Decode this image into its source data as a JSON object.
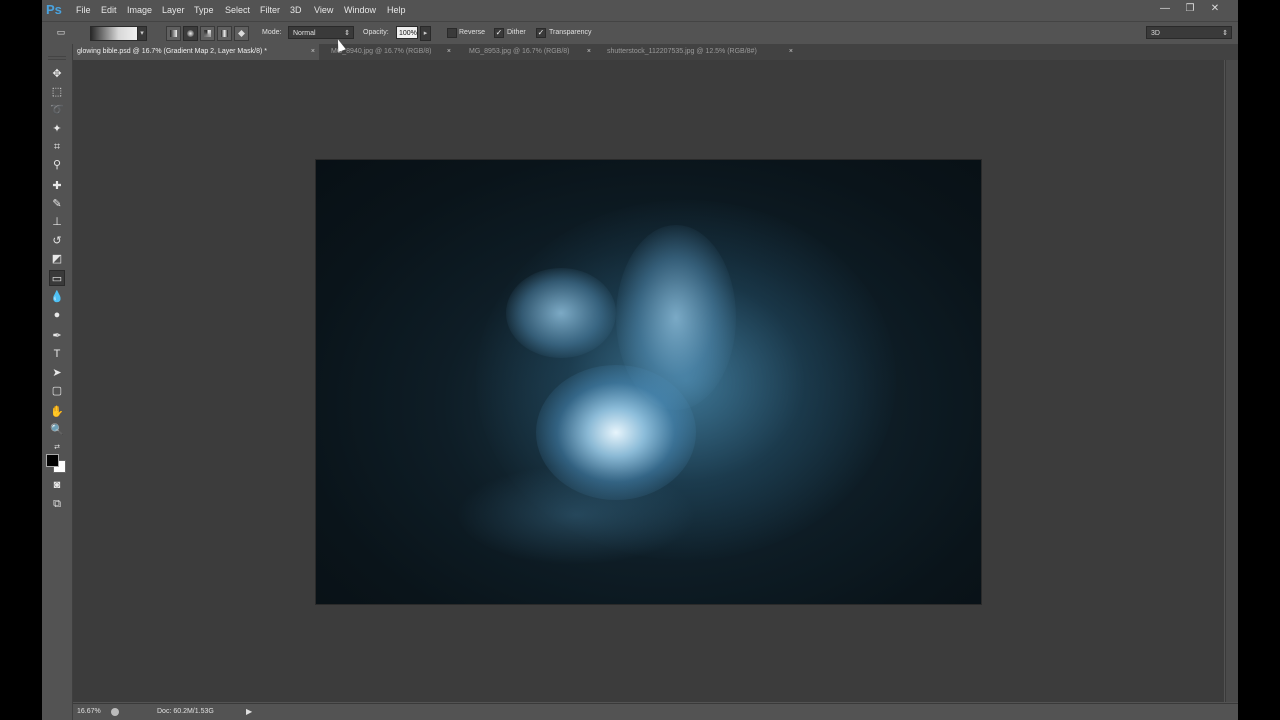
{
  "app": {
    "logo": "Ps"
  },
  "menu": [
    "File",
    "Edit",
    "Image",
    "Layer",
    "Type",
    "Select",
    "Filter",
    "3D",
    "View",
    "Window",
    "Help"
  ],
  "window_controls": {
    "minimize": "—",
    "restore": "❐",
    "close": "✕"
  },
  "options_bar": {
    "mode_label": "Mode:",
    "mode_value": "Normal",
    "opacity_label": "Opacity:",
    "opacity_value": "100%",
    "reverse_label": "Reverse",
    "dither_label": "Dither",
    "transparency_label": "Transparency",
    "reverse_checked": false,
    "dither_checked": true,
    "transparency_checked": true,
    "workspace": "3D"
  },
  "tabs": [
    {
      "label": "glowing bible.psd @ 16.7% (Gradient Map 2, Layer Mask/8) *",
      "close": "×"
    },
    {
      "label": "MG_8940.jpg @ 16.7% (RGB/8)",
      "close": "×"
    },
    {
      "label": "MG_8953.jpg @ 16.7% (RGB/8)",
      "close": "×"
    },
    {
      "label": "shutterstock_112207535.jpg @ 12.5% (RGB/8#)",
      "close": "×"
    }
  ],
  "status": {
    "zoom": "16.67%",
    "doc": "Doc: 60.2M/1.53G",
    "arrow": "▶"
  },
  "colors": {
    "foreground": "#000000",
    "background": "#ffffff",
    "ui_panel": "#535353",
    "canvas_bg": "#3c3c3c"
  }
}
